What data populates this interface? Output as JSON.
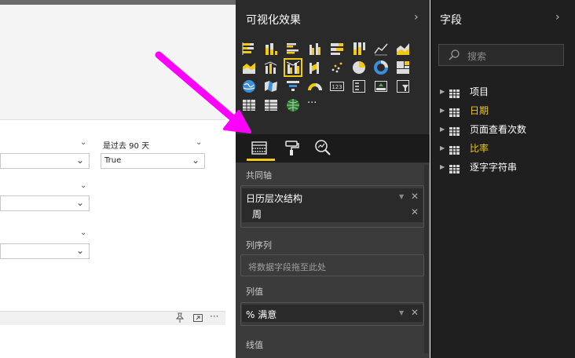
{
  "visualizations": {
    "title": "可视化效果",
    "collapse_icon": "chevron-right-icon"
  },
  "fields": {
    "title": "字段",
    "collapse_icon": "chevron-right-icon",
    "search_placeholder": "搜索"
  },
  "gallery": {
    "more_label": "···",
    "items": [
      {
        "name": "stacked-bar-chart-icon"
      },
      {
        "name": "stacked-column-chart-icon"
      },
      {
        "name": "clustered-bar-chart-icon"
      },
      {
        "name": "clustered-column-chart-icon"
      },
      {
        "name": "100-stacked-bar-chart-icon"
      },
      {
        "name": "100-stacked-column-chart-icon"
      },
      {
        "name": "line-chart-icon"
      },
      {
        "name": "area-chart-icon"
      },
      {
        "name": "stacked-area-chart-icon"
      },
      {
        "name": "line-and-stacked-column-chart-icon"
      },
      {
        "name": "line-and-clustered-column-chart-icon",
        "selected": true
      },
      {
        "name": "ribbon-chart-icon"
      },
      {
        "name": "scatter-chart-icon"
      },
      {
        "name": "pie-chart-icon"
      },
      {
        "name": "donut-chart-icon"
      },
      {
        "name": "treemap-icon"
      },
      {
        "name": "map-icon"
      },
      {
        "name": "filled-map-icon"
      },
      {
        "name": "funnel-icon"
      },
      {
        "name": "gauge-icon"
      },
      {
        "name": "card-icon"
      },
      {
        "name": "multi-row-card-icon"
      },
      {
        "name": "kpi-icon"
      },
      {
        "name": "slicer-icon"
      },
      {
        "name": "table-icon"
      },
      {
        "name": "matrix-icon"
      },
      {
        "name": "globe-icon"
      }
    ]
  },
  "tabs": [
    {
      "name": "fields-tab-icon",
      "active": true
    },
    {
      "name": "format-paint-roller-icon"
    },
    {
      "name": "analytics-magnifier-icon"
    }
  ],
  "wells": {
    "shared_axis": {
      "label": "共同轴",
      "fields": [
        "日历层次结构",
        "周"
      ]
    },
    "column_series": {
      "label": "列序列",
      "placeholder": "将数据字段拖至此处"
    },
    "column_values": {
      "label": "列值",
      "fields": [
        "% 满意"
      ]
    },
    "line_values": {
      "label": "线值"
    }
  },
  "field_list": [
    {
      "label": "项目",
      "highlight": false
    },
    {
      "label": "日期",
      "highlight": true
    },
    {
      "label": "页面查看次数",
      "highlight": false
    },
    {
      "label": "比率",
      "highlight": true
    },
    {
      "label": "逐字字符串",
      "highlight": false
    }
  ],
  "canvas": {
    "slicer_title": "是过去 90 天",
    "slicer_value": "True",
    "visual_header_icons": [
      "pin-icon",
      "focus-mode-icon",
      "more-options-icon"
    ],
    "more_options_label": "···"
  },
  "colors": {
    "accent": "#f2c811",
    "pane_bg": "#2a2a2a",
    "fields_bg": "#1f1f1f",
    "annotation_arrow": "#ff00ff"
  }
}
